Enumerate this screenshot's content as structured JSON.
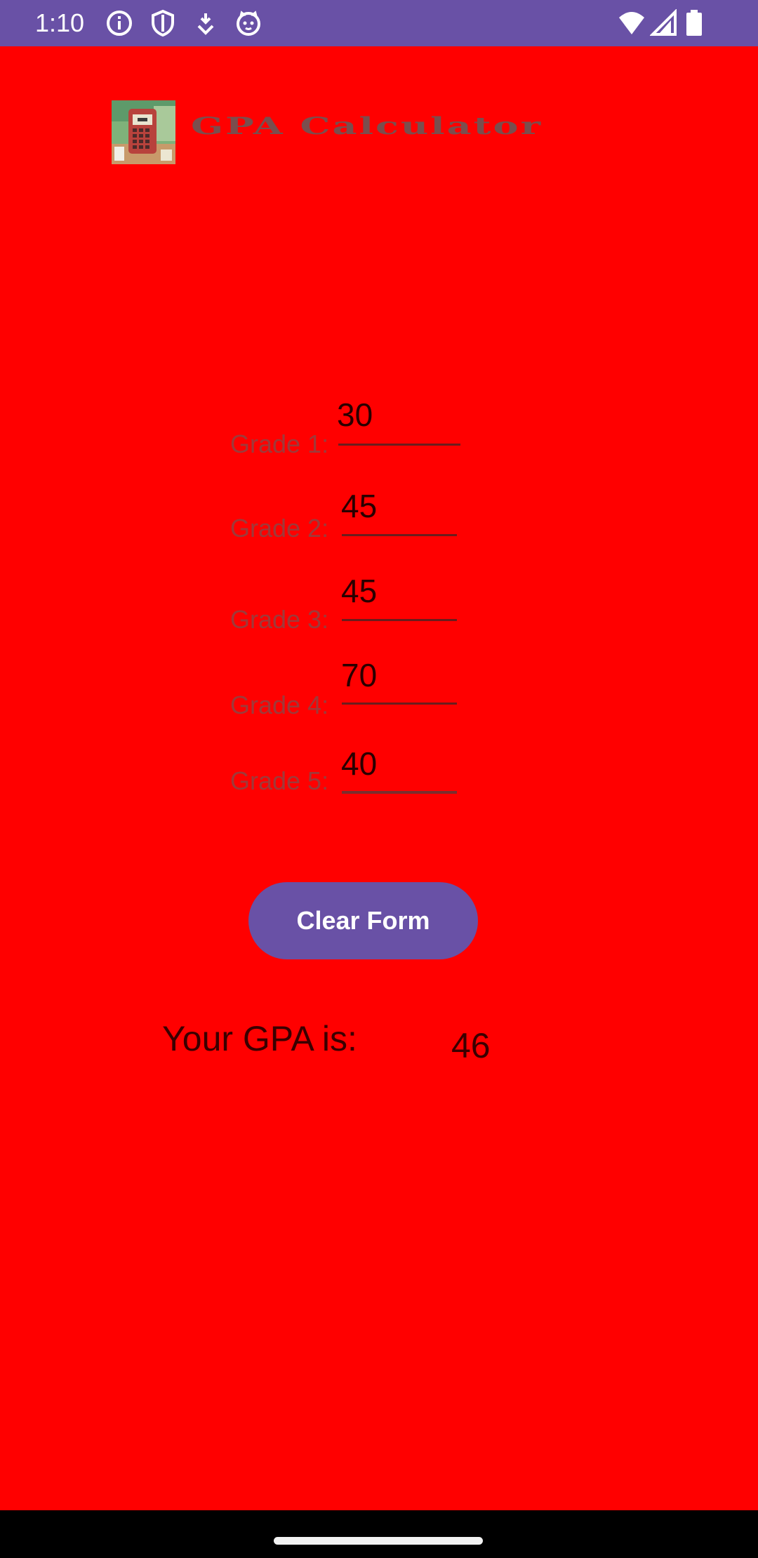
{
  "status_bar": {
    "time": "1:10",
    "icons": [
      "info-icon",
      "shield-icon",
      "download-icon",
      "cat-face-icon",
      "wifi-icon",
      "signal-icon",
      "battery-icon"
    ],
    "color": "#6951A6"
  },
  "app": {
    "title": "GPA Calculator",
    "logo_icon": "calculator-logo-icon",
    "background": "#FF0000"
  },
  "grades": [
    {
      "label": "Grade 1:",
      "value": "30"
    },
    {
      "label": "Grade 2:",
      "value": "45"
    },
    {
      "label": "Grade 3:",
      "value": "45"
    },
    {
      "label": "Grade 4:",
      "value": "70"
    },
    {
      "label": "Grade 5:",
      "value": "40"
    }
  ],
  "clear_button": {
    "label": "Clear Form",
    "color": "#6951A6"
  },
  "result": {
    "label": "Your GPA is:",
    "value": "46"
  }
}
